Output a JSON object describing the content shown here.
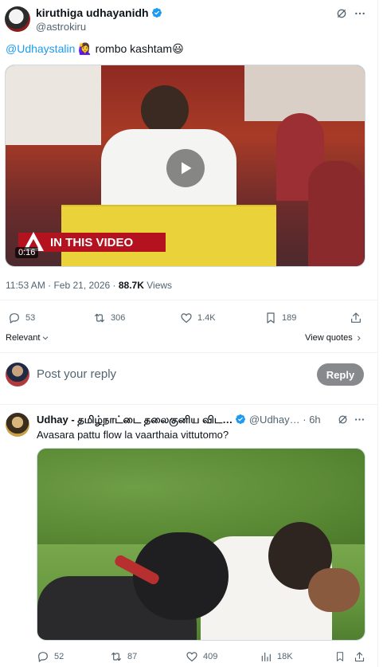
{
  "tweet": {
    "author_name": "kiruthiga udhayanidh",
    "author_handle": "@astrokiru",
    "mention": "@Udhaystalin",
    "text_tail": "rombo kashtam",
    "emoji_1": "🙋‍♀️",
    "emoji_2": "😃",
    "video_badge": "IN THIS VIDEO",
    "video_time": "0:16",
    "timestamp": "11:53 AM · Feb 21, 2026 · ",
    "views_count": "88.7K",
    "views_label": "Views",
    "replies": "53",
    "reposts": "306",
    "likes": "1.4K",
    "bookmarks": "189",
    "relevant_label": "Relevant",
    "view_quotes": "View quotes"
  },
  "compose": {
    "placeholder": "Post your reply",
    "reply_button": "Reply"
  },
  "reply": {
    "author_name": "Udhay - தமிழ்நாட்டை தலைகுனிய விட…",
    "author_handle": "@Udhay…",
    "time": "· 6h",
    "text": "Avasara pattu  flow la vaarthaia vittutomo?",
    "replies": "52",
    "reposts": "87",
    "likes": "409",
    "views": "18K"
  },
  "colors": {
    "accent": "#1d9bf0",
    "secondary_text": "#536471",
    "badge_red": "#b3121e",
    "reply_button_bg": "#87898c"
  }
}
